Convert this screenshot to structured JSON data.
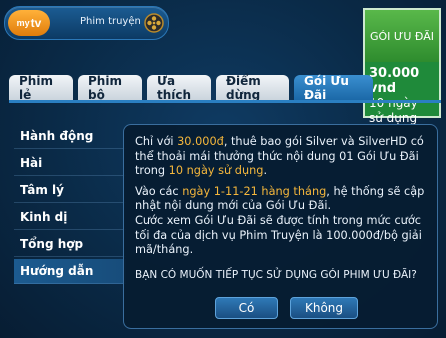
{
  "header": {
    "logo_text": "my",
    "logo_text2": "tv",
    "title": "Phim truyện"
  },
  "promo": {
    "title": "GÓI ƯU ĐÃI",
    "price": "30.000 vnd",
    "duration": "10 ngày sử dụng"
  },
  "tabs": [
    {
      "label": "Phim lẻ"
    },
    {
      "label": "Phim bộ"
    },
    {
      "label": "Ưa thích"
    },
    {
      "label": "Điểm dừng"
    },
    {
      "label": "Gói Ưu Đãi"
    }
  ],
  "sidebar": {
    "items": [
      {
        "label": "Hành động"
      },
      {
        "label": "Hài"
      },
      {
        "label": "Tâm lý"
      },
      {
        "label": "Kinh dị"
      },
      {
        "label": "Tổng hợp"
      },
      {
        "label": "Hướng dẫn"
      }
    ]
  },
  "dialog": {
    "p1_a": "Chỉ với ",
    "p1_price": "30.000đ",
    "p1_b": ", thuê bao gói Silver và SilverHD có thể thoải mái thưởng thức nội dung 01 Gói Ưu Đãi trong ",
    "p1_days": "10 ngày sử dụng",
    "p1_c": ".",
    "p2_a": "Vào các ",
    "p2_dates": "ngày 1-11-21 hàng tháng",
    "p2_b": ", hệ thống sẽ cập nhật nội dung mới của Gói Ưu Đãi.",
    "p3": "Cước xem Gói Ưu Đãi sẽ được tính trong mức cước tối đa của dịch vụ Phim Truyện là 100.000đ/bộ giải mã/tháng.",
    "question": "BẠN CÓ MUỐN TIẾP TỤC SỬ DỤNG GÓI PHIM ƯU ĐÃI?",
    "yes_label": "Có",
    "no_label": "Không"
  },
  "colors": {
    "accent": "#2a7fc2",
    "highlight": "#f5b73c",
    "promo_green": "#1f8a3a"
  }
}
